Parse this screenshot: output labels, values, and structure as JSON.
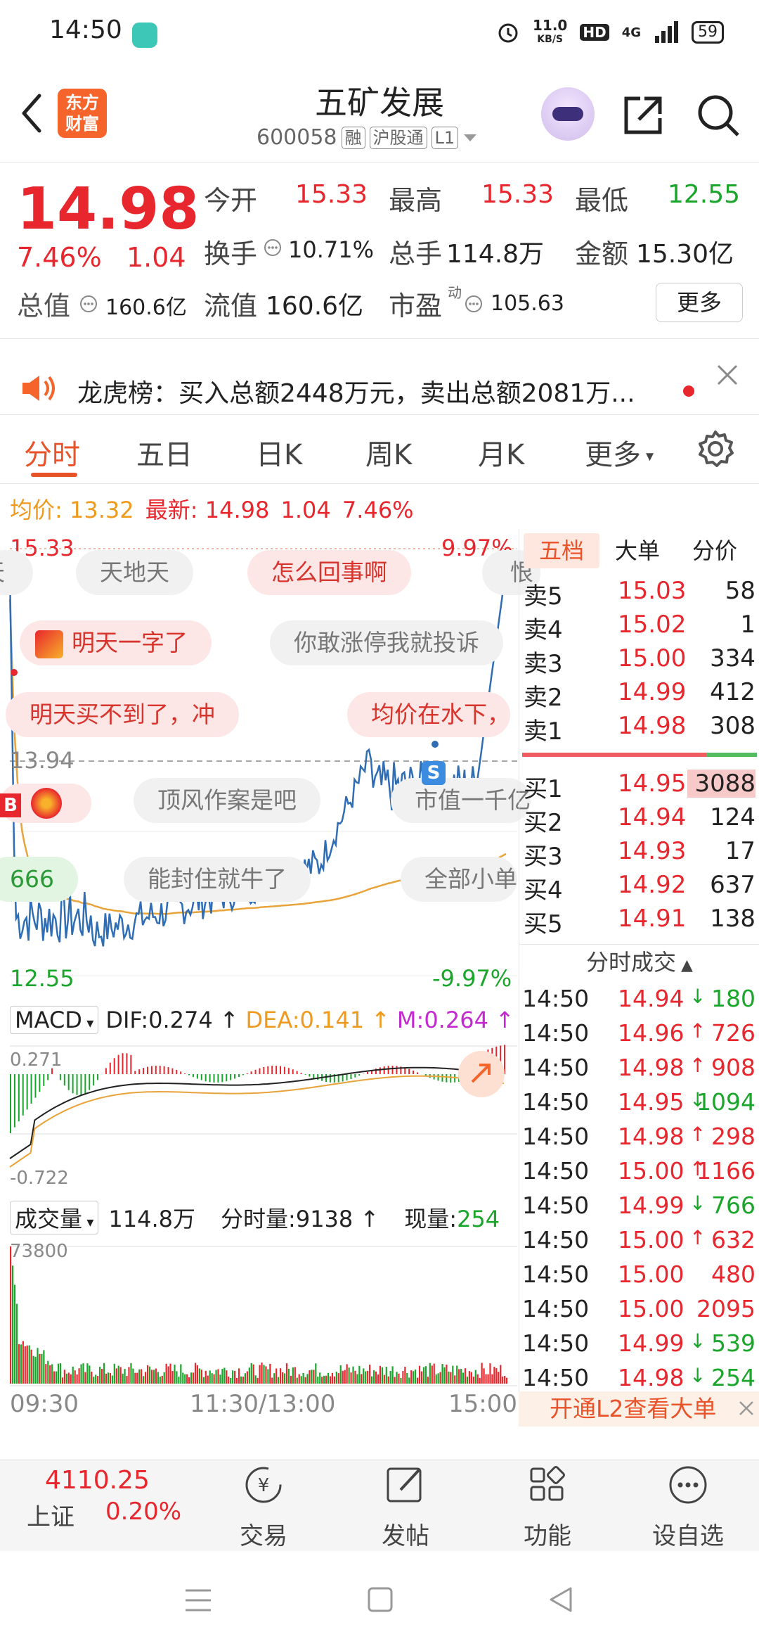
{
  "status_bar": {
    "time": "14:50",
    "net_speed_value": "11.0",
    "net_speed_unit": "KB/S",
    "hd": "HD",
    "network": "4G",
    "battery": "59"
  },
  "header": {
    "brand": "东方财富",
    "stock_name": "五矿发展",
    "stock_code": "600058",
    "tags": [
      "融",
      "沪股通",
      "L1"
    ]
  },
  "quote": {
    "price": "14.98",
    "change_pct": "7.46%",
    "change_amt": "1.04",
    "open_label": "今开",
    "open": "15.33",
    "high_label": "最高",
    "high": "15.33",
    "low_label": "最低",
    "low": "12.55",
    "turnover_label": "换手",
    "turnover": "10.71%",
    "volume_label": "总手",
    "volume": "114.8万",
    "amount_label": "金额",
    "amount": "15.30亿",
    "total_mv_label": "总值",
    "total_mv": "160.6亿",
    "float_mv_label": "流值",
    "float_mv": "160.6亿",
    "pe_label": "市盈",
    "pe_sup": "动",
    "pe": "105.63",
    "more": "更多"
  },
  "notice": {
    "text": "龙虎榜：买入总额2448万元，卖出总额2081万..."
  },
  "tabs": [
    "分时",
    "五日",
    "日K",
    "周K",
    "月K",
    "更多"
  ],
  "summary": {
    "avg_label": "均价:",
    "avg": "13.32",
    "latest_label": "最新:",
    "latest": "14.98",
    "chg": "1.04",
    "pct": "7.46%"
  },
  "intraday": {
    "high_label": "15.33",
    "high_pct": "9.97%",
    "mid_label": "13.94",
    "low_label": "12.55",
    "low_pct": "-9.97%",
    "marker_b": "B",
    "marker_s": "S"
  },
  "bubbles": [
    "天",
    "天地天",
    "怎么回事啊",
    "恨",
    "明天一字了",
    "你敢涨停我就投诉",
    "明天买不到了，冲",
    "均价在水下，",
    "顶风作案是吧",
    "市值一千亿",
    "666",
    "能封住就牛了",
    "全部小单"
  ],
  "macd": {
    "name": "MACD",
    "dif": "DIF:0.274",
    "dea": "DEA:0.141",
    "m": "M:0.264",
    "top_label": "0.271",
    "bottom_label": "-0.722"
  },
  "volume_panel": {
    "name": "成交量",
    "total": "114.8万",
    "fen_label": "分时量:9138",
    "now_label": "现量:",
    "now_value": "254",
    "max_label": "73800"
  },
  "time_axis": [
    "09:30",
    "11:30/13:00",
    "15:00"
  ],
  "orderbook": {
    "tabs": [
      "五档",
      "大单",
      "分价"
    ],
    "asks": [
      {
        "label": "卖5",
        "price": "15.03",
        "vol": "58"
      },
      {
        "label": "卖4",
        "price": "15.02",
        "vol": "1"
      },
      {
        "label": "卖3",
        "price": "15.00",
        "vol": "334"
      },
      {
        "label": "卖2",
        "price": "14.99",
        "vol": "412"
      },
      {
        "label": "卖1",
        "price": "14.98",
        "vol": "308"
      }
    ],
    "bids": [
      {
        "label": "买1",
        "price": "14.95",
        "vol": "3088"
      },
      {
        "label": "买2",
        "price": "14.94",
        "vol": "124"
      },
      {
        "label": "买3",
        "price": "14.93",
        "vol": "17"
      },
      {
        "label": "买4",
        "price": "14.92",
        "vol": "637"
      },
      {
        "label": "买5",
        "price": "14.91",
        "vol": "138"
      }
    ]
  },
  "trades": {
    "title": "分时成交",
    "rows": [
      {
        "time": "14:50",
        "price": "14.94",
        "dir": "down",
        "vol": "180"
      },
      {
        "time": "14:50",
        "price": "14.96",
        "dir": "up",
        "vol": "726"
      },
      {
        "time": "14:50",
        "price": "14.98",
        "dir": "up",
        "vol": "908"
      },
      {
        "time": "14:50",
        "price": "14.95",
        "dir": "down",
        "vol": "1094"
      },
      {
        "time": "14:50",
        "price": "14.98",
        "dir": "up",
        "vol": "298"
      },
      {
        "time": "14:50",
        "price": "15.00",
        "dir": "up",
        "vol": "1166"
      },
      {
        "time": "14:50",
        "price": "14.99",
        "dir": "down",
        "vol": "766"
      },
      {
        "time": "14:50",
        "price": "15.00",
        "dir": "up",
        "vol": "632"
      },
      {
        "time": "14:50",
        "price": "15.00",
        "dir": "none",
        "vol": "480"
      },
      {
        "time": "14:50",
        "price": "15.00",
        "dir": "none",
        "vol": "2095"
      },
      {
        "time": "14:50",
        "price": "14.99",
        "dir": "down",
        "vol": "539"
      },
      {
        "time": "14:50",
        "price": "14.98",
        "dir": "down",
        "vol": "254"
      }
    ],
    "l2_banner": "开通L2查看大单"
  },
  "bottom_bar": {
    "index_value": "4110.25",
    "index_name": "上证",
    "index_pct": "0.20%",
    "items": [
      "交易",
      "发帖",
      "功能",
      "设自选"
    ]
  },
  "colors": {
    "up": "#e8262d",
    "down": "#1aa52b",
    "accent": "#e8532a",
    "price_line": "#2f6db5",
    "avg_line": "#e8a33a"
  }
}
